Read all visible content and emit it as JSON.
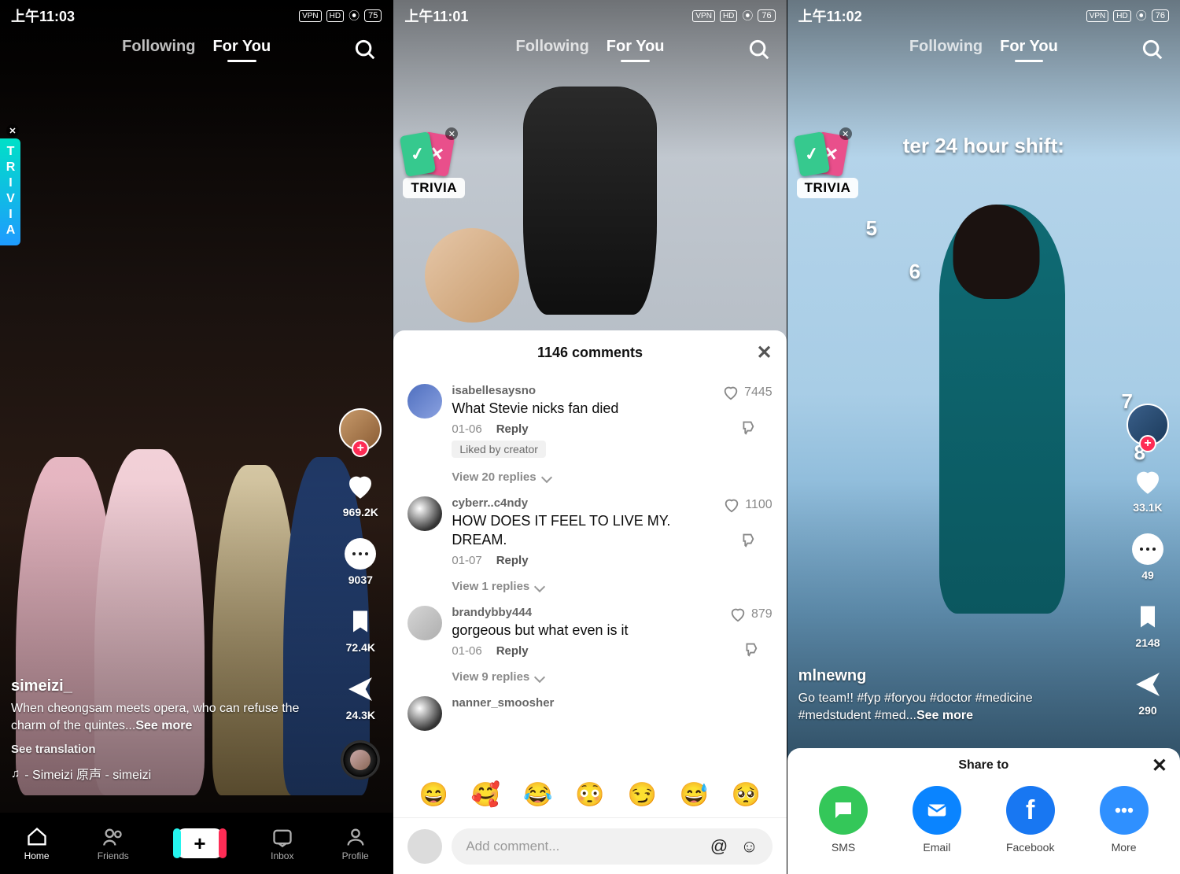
{
  "tabs": {
    "following": "Following",
    "foryou": "For You"
  },
  "trivia_label": "TRIVIA",
  "screen1": {
    "time": "上午11:03",
    "battery": "75",
    "user": "simeizi_",
    "caption_a": "When cheongsam meets opera, who can refuse the charm of the quintes...",
    "see_more": "See more",
    "see_translation": "See translation",
    "music": "- Simeizi   原声 - simeizi",
    "counts": {
      "likes": "969.2K",
      "comments": "9037",
      "saves": "72.4K",
      "shares": "24.3K"
    }
  },
  "bottomnav": {
    "home": "Home",
    "friends": "Friends",
    "inbox": "Inbox",
    "profile": "Profile"
  },
  "screen2": {
    "time": "上午11:01",
    "battery": "76",
    "comments_header": "1146 comments",
    "comments": [
      {
        "name": "isabellesaysno",
        "text": "What Stevie nicks fan died",
        "date": "01-06",
        "reply": "Reply",
        "likes": "7445",
        "liked_by_creator": "Liked by creator",
        "view": "View 20 replies"
      },
      {
        "name": "cyberr..c4ndy",
        "text": "HOW DOES IT FEEL TO LIVE MY. DREAM.",
        "date": "01-07",
        "reply": "Reply",
        "likes": "1100",
        "view": "View 1 replies"
      },
      {
        "name": "brandybby444",
        "text": "gorgeous but what even is it",
        "date": "01-06",
        "reply": "Reply",
        "likes": "879",
        "view": "View 9 replies"
      },
      {
        "name": "nanner_smoosher",
        "text": "",
        "date": "",
        "reply": "",
        "likes": "",
        "view": ""
      }
    ],
    "emoji": [
      "😄",
      "🥰",
      "😂",
      "😳",
      "😏",
      "😅",
      "🥺"
    ],
    "add_comment": "Add comment..."
  },
  "screen3": {
    "time": "上午11:02",
    "battery": "76",
    "overlay_text": "ter 24 hour shift:",
    "nums": {
      "n5": "5",
      "n6": "6",
      "n7": "7",
      "n8": "8"
    },
    "user": "mlnewng",
    "caption": "Go team!! #fyp #foryou #doctor #medicine #medstudent #med...",
    "see_more": "See more",
    "counts": {
      "likes": "33.1K",
      "comments": "49",
      "saves": "2148",
      "shares": "290"
    },
    "share_title": "Share to",
    "share": {
      "sms": "SMS",
      "email": "Email",
      "fb": "Facebook",
      "more": "More"
    }
  }
}
